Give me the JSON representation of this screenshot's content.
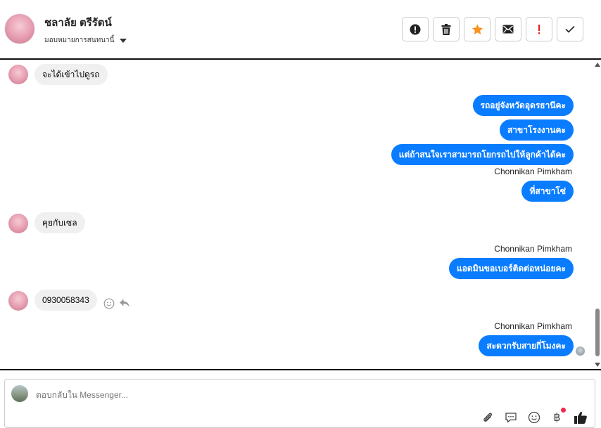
{
  "header": {
    "contact_name": "ชลาลัย ตรีรัตน์",
    "assign_label": "มอบหมายการสนทนานี้"
  },
  "actions": [
    {
      "name": "spam-button",
      "icon": "exclamation-circle-icon"
    },
    {
      "name": "delete-button",
      "icon": "trash-icon"
    },
    {
      "name": "star-button",
      "icon": "star-icon",
      "color": "#f7931e"
    },
    {
      "name": "mark-unread-button",
      "icon": "envelope-icon"
    },
    {
      "name": "follow-up-button",
      "icon": "exclamation-mark-icon",
      "color": "#e02020"
    },
    {
      "name": "mark-done-button",
      "icon": "checkmark-icon"
    }
  ],
  "messages": {
    "m1": "จะได้เข้าไปดูรถ",
    "m2": "รถอยู่จังหวัดอุดรธานีคะ",
    "m3": "สาขาโรงงานคะ",
    "m4": "แต่ถ้าสนใจเราสามารถโยกรถไปให้ลูกค้าได้คะ",
    "s1": "Chonnikan Pimkham",
    "m5": "ที่สาขาโซ่",
    "m6": "คุยกับเซล",
    "s2": "Chonnikan Pimkham",
    "m7": "แอดมินขอเบอร์ติดต่อหน่อยคะ",
    "m8": "0930058343",
    "s3": "Chonnikan Pimkham",
    "m9": "สะดวกรับสายกี่โมงคะ"
  },
  "composer": {
    "placeholder": "ตอบกลับใน Messenger..."
  },
  "colors": {
    "outgoing_bubble": "#0a7cff",
    "incoming_bubble": "#f0f0f0"
  }
}
